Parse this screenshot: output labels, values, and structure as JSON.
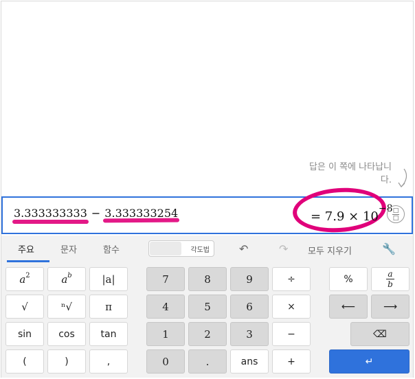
{
  "hint": {
    "line1": "답은 이 쪽에 나타납니",
    "line2": "다."
  },
  "expression": {
    "left": "3.333333333",
    "operator": "−",
    "right": "3.333333254",
    "result_prefix": "= 7.9 × 10",
    "result_exponent": "−8",
    "fraction_top": "□",
    "fraction_bottom": "□"
  },
  "tabs": [
    {
      "label": "주요",
      "active": true
    },
    {
      "label": "문자",
      "active": false
    },
    {
      "label": "함수",
      "active": false
    }
  ],
  "toolbar": {
    "angle_label": "각도법",
    "undo_icon": "undo-icon",
    "redo_icon": "redo-icon",
    "clear_all": "모두 지우기",
    "settings_icon": "wrench-icon"
  },
  "keys": {
    "a_sq": {
      "base": "a",
      "exp": "2"
    },
    "a_b": {
      "base": "a",
      "exp": "b"
    },
    "abs": "|a|",
    "sqrt": "√",
    "nroot": "ⁿ√",
    "pi": "π",
    "sin": "sin",
    "cos": "cos",
    "tan": "tan",
    "lparen": "(",
    "rparen": ")",
    "comma": ",",
    "n7": "7",
    "n8": "8",
    "n9": "9",
    "div": "÷",
    "n4": "4",
    "n5": "5",
    "n6": "6",
    "mul": "×",
    "n1": "1",
    "n2": "2",
    "n3": "3",
    "minus": "−",
    "n0": "0",
    "dot": ".",
    "ans": "ans",
    "plus": "+",
    "percent": "%",
    "frac_top": "a",
    "frac_bottom": "b",
    "left": "⟵",
    "right": "⟶",
    "backspace": "⌫",
    "enter": "↵"
  },
  "colors": {
    "accent": "#2f72dc",
    "annotation": "#e0007a"
  }
}
